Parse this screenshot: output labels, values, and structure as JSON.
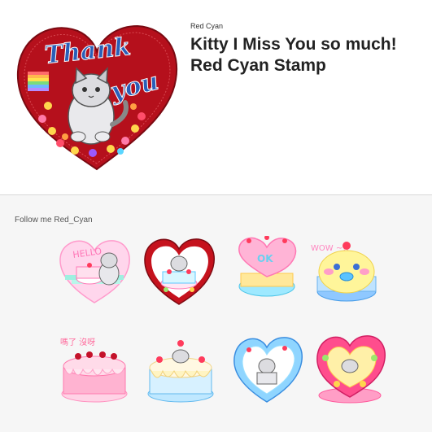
{
  "product": {
    "author": "Red Cyan",
    "title": "Kitty I Miss You so much! Red Cyan Stamp",
    "main_sticker_text": [
      "Thank",
      "you"
    ]
  },
  "description": "Follow me Red_Cyan",
  "stickers": [
    {
      "name": "sticker-hello-cake-heart",
      "text": "HELLO"
    },
    {
      "name": "sticker-red-heart-cake",
      "text": ""
    },
    {
      "name": "sticker-pink-heart-cake",
      "text": "OK"
    },
    {
      "name": "sticker-wow-face-cake",
      "text": "WOW ~!!"
    },
    {
      "name": "sticker-pink-drip-cake",
      "text": "嗎了 沒呀"
    },
    {
      "name": "sticker-cat-cream-cake",
      "text": ""
    },
    {
      "name": "sticker-blue-heart-cake",
      "text": ""
    },
    {
      "name": "sticker-flower-heart-cake",
      "text": ""
    }
  ],
  "colors": {
    "heart_red": "#b5101c",
    "title_text": "#222222",
    "divider": "#d9d9d9",
    "panel_bg": "#f6f6f6"
  }
}
